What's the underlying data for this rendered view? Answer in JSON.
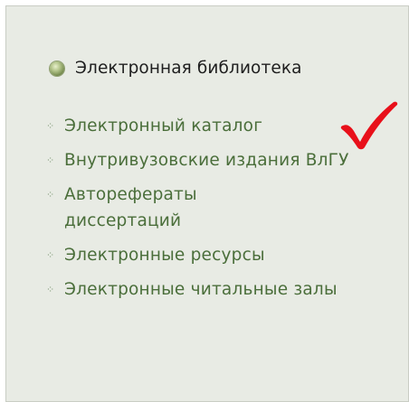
{
  "panel": {
    "heading": "Электронная библиотека",
    "items": [
      {
        "label": "Электронный каталог"
      },
      {
        "label": "Внутривузовские издания ВлГУ"
      },
      {
        "label": "Авторефераты диссертаций"
      },
      {
        "label": "Электронные ресурсы"
      },
      {
        "label": "Электронные читальные залы"
      }
    ]
  },
  "icons": {
    "heading_bullet": "round-bullet-icon",
    "item_bullet": "diamond-dot-icon",
    "annotation": "checkmark-icon"
  },
  "colors": {
    "panel_bg": "#e8ebe4",
    "link": "#4a6e3a",
    "heading": "#1e1e1e",
    "checkmark": "#e8101a"
  }
}
